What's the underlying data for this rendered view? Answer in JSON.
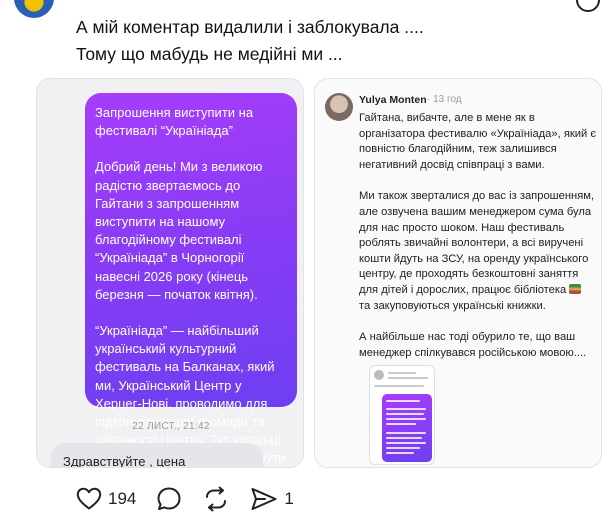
{
  "post": {
    "text_lines": [
      "А мій коментар видалили і заблокувала ....",
      "Тому що мабудь не медійні ми ..."
    ]
  },
  "dm_screenshot": {
    "bubble_paragraphs": [
      "Запрошення виступити на фестивалі “Україніада”",
      "Добрий день! Ми з великою радістю звертаємось до Гайтани з запрошенням виступити на нашому благодійному фестивалі “Україніада” в Чорногорії навесні 2026 року (кінець березня — початок квітня).",
      "“Україніада” — найбільший український культурний фестиваль на Балканах, який ми, Український Центр у Херцег-Нові, проводимо для підтримки нашої громади та діяльності Центру. Тут українці збираються разом, щоб відчути дім, культуру та єдність — навіть далеко від Батьківщини."
    ],
    "timestamp": "22 ЛИСТ., 21:42",
    "reply_text": "Здравствуйте , цена выступления"
  },
  "comment_screenshot": {
    "author": "Yulya Monten",
    "time": "· 13 год",
    "paragraphs": [
      "Гайтана, вибачте, але в мене як в організатора фестивалю «Україніада», який є повністю благодійним, теж залишився негативний досвід співпраці з вами.",
      "Ми також зверталися до вас із запрошенням, але озвучена вашим менеджером сума була для нас просто шоком. Наш фестиваль роблять звичайні волонтери, а всі виручені кошти йдуть на ЗСУ, на оренду українського центру, де проходять безкоштовні заняття для дітей і дорослих, працює бібліотека",
      "А найбільше нас тоді обурило те, що ваш менеджер спілкувався російською мовою...."
    ],
    "paragraph2_tail": "та закуповуються українські книжки."
  },
  "actions": {
    "likes": "194",
    "shares": "1"
  },
  "icons": [
    "heart-icon",
    "comment-icon",
    "repost-icon",
    "share-icon",
    "more-icon"
  ]
}
